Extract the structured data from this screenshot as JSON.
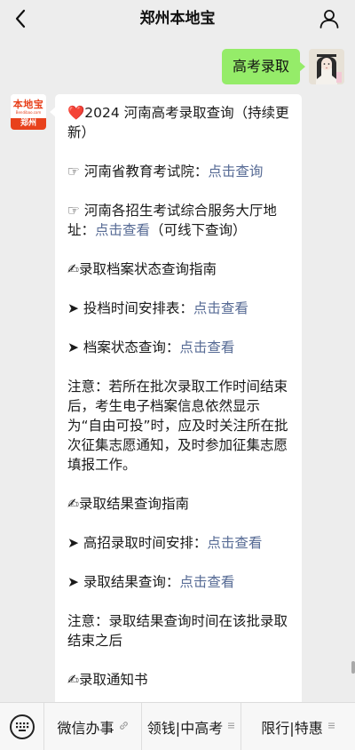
{
  "header": {
    "title": "郑州本地宝",
    "back_icon": "chevron-left-icon",
    "profile_icon": "person-icon"
  },
  "outgoing": {
    "text": "高考录取"
  },
  "sender_avatar": {
    "brand": "本地宝",
    "brand_sub": "Bendibao.com",
    "city": "郑州"
  },
  "message": {
    "line1": "❤️2024 河南高考录取查询（持续更新）",
    "item1_prefix": "☞ 河南省教育考试院：",
    "item1_link": "点击查询",
    "item2_prefix": "☞ 河南各招生考试综合服务大厅地址：",
    "item2_link": "点击查看",
    "item2_suffix": "（可线下查询）",
    "section1": "✍录取档案状态查询指南",
    "item3_prefix": "➤ 投档时间安排表：",
    "item3_link": "点击查看",
    "item4_prefix": "➤ 档案状态查询：",
    "item4_link": "点击查看",
    "note1": "注意：若所在批次录取工作时间结束后，考生电子档案信息依然显示为“自由可投”时，应及时关注所在批次征集志愿通知，及时参加征集志愿填报工作。",
    "section2": "✍录取结果查询指南",
    "item5_prefix": "➤ 高招录取时间安排：",
    "item5_link": "点击查看",
    "item6_prefix": "➤ 录取结果查询：",
    "item6_link": "点击查看",
    "note2": "注意：录取结果查询时间在该批录取结束之后",
    "section3": "✍录取通知书"
  },
  "bottom_menu": {
    "keyboard_icon": "keyboard-icon",
    "items": [
      {
        "label": "微信办事",
        "icon": "link-icon"
      },
      {
        "label": "领钱|中高考",
        "icon": "menu-lines-icon"
      },
      {
        "label": "限行|特惠",
        "icon": "menu-lines-icon"
      }
    ]
  },
  "colors": {
    "background": "#ededed",
    "outgoing_bubble": "#95ec69",
    "link": "#576b95",
    "brand_red": "#e8411c"
  }
}
